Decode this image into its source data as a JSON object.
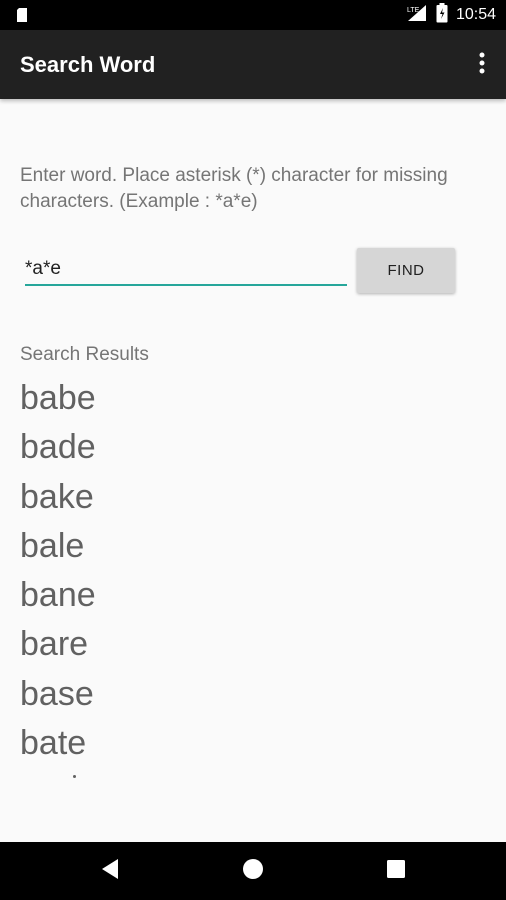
{
  "status_bar": {
    "time": "10:54",
    "icons": [
      "sd-card-icon",
      "lte-signal-icon",
      "battery-icon"
    ]
  },
  "app_bar": {
    "title": "Search Word",
    "overflow_icon": "more-vert-icon"
  },
  "instructions": "Enter word. Place asterisk (*) character for missing characters. (Example : *a*e)",
  "search": {
    "value": "*a*e",
    "button_label": "FIND"
  },
  "results": {
    "heading": "Search Results",
    "items": [
      "babe",
      "bade",
      "bake",
      "bale",
      "bane",
      "bare",
      "base",
      "bate"
    ]
  },
  "nav_bar": {
    "icons": [
      "back-icon",
      "home-icon",
      "recents-icon"
    ]
  },
  "colors": {
    "status_bar": "#000000",
    "app_bar": "#212121",
    "accent": "#26a69a",
    "background": "#fafafa",
    "button": "#d6d6d6"
  }
}
